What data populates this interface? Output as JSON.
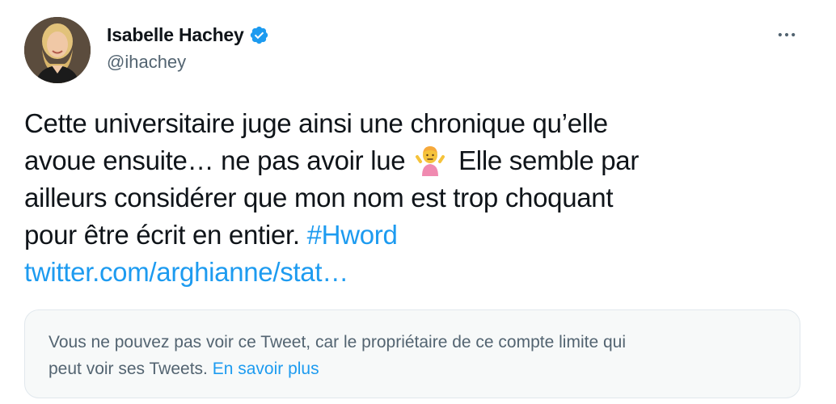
{
  "author": {
    "display_name": "Isabelle Hachey",
    "handle": "@ihachey",
    "verified": true
  },
  "tweet": {
    "line1": "Cette universitaire juge ainsi une chronique qu’elle",
    "line2_before_emoji": "avoue ensuite… ne pas avoir lue",
    "line2_after_emoji": "Elle semble par",
    "emoji_icon": "person-shrugging-emoji",
    "line3": "ailleurs considérer que mon nom est trop choquant",
    "line4_text": "pour être écrit en entier.",
    "hashtag": "#Hword",
    "url": "twitter.com/arghianne/stat…"
  },
  "quoted_notice": {
    "line1": "Vous ne pouvez pas voir ce Tweet, car le propriétaire de ce compte limite qui",
    "line2_text": "peut voir ses Tweets.",
    "learn_more": "En savoir plus"
  },
  "colors": {
    "link": "#1d9bf0",
    "secondary_text": "#536471",
    "primary_text": "#0f1419",
    "notice_background": "#f7f9f9"
  }
}
